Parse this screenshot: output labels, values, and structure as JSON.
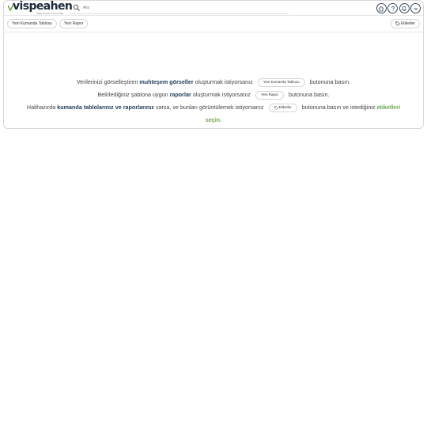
{
  "header": {
    "logo_text": "vispeahen",
    "logo_tagline": "Make Sense of Your Data",
    "search_placeholder": "Ara",
    "icons": [
      "home-icon",
      "help-icon",
      "bell-icon",
      "chevron-down-icon"
    ]
  },
  "toolbar": {
    "new_dashboard_label": "Yeni Kumanda Tablosu",
    "new_report_label": "Yeni Rapor",
    "tags_label": "Etiketler"
  },
  "message": {
    "line1": {
      "pre": "Verilerinizi görselleştiren",
      "highlight": "muhteşem görseller",
      "mid": "oluşturmak istiyorsanız",
      "button": "Yeni Kumanda Tablosu",
      "post": "butonuna basın."
    },
    "line2": {
      "pre": "Belirlediğiniz şablona uygun",
      "highlight": "raporlar",
      "mid": "oluşturmak istiyorsanız",
      "button": "Yeni Rapor",
      "post": "butonuna basın."
    },
    "line3": {
      "pre": "Halihazırda",
      "highlight": "kumanda tablolarınız ve raporlarınız",
      "mid": "varsa, ve bunları görüntülemek istiyorsanız",
      "button": "Etiketler",
      "post": "butonuna basın ve istediğiniz",
      "green": "etiketleri"
    },
    "line4": {
      "green": "seçin."
    }
  },
  "colors": {
    "brand_dark": "#1f3b5a",
    "accent_green": "#6aa84f"
  }
}
